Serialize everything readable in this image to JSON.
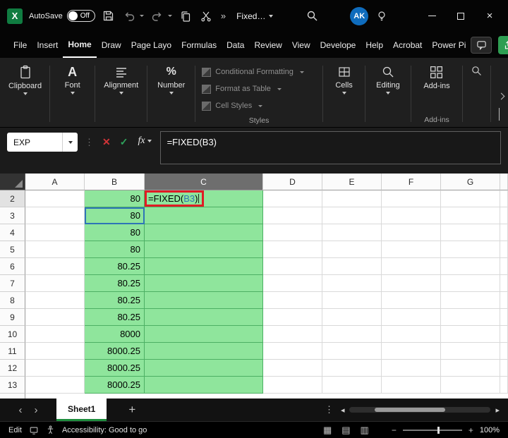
{
  "title_bar": {
    "autosave_label": "AutoSave",
    "autosave_state": "Off",
    "overflow_chevron": "»",
    "doc_title": "Fixed…",
    "avatar_initials": "AK"
  },
  "ribbon_tabs": {
    "active": "Home",
    "items": [
      "File",
      "Insert",
      "Home",
      "Draw",
      "Page Layo",
      "Formulas",
      "Data",
      "Review",
      "View",
      "Develope",
      "Help",
      "Acrobat",
      "Power Pi"
    ]
  },
  "ribbon": {
    "clipboard_label": "Clipboard",
    "font_label": "Font",
    "alignment_label": "Alignment",
    "number_label": "Number",
    "styles_group_label": "Styles",
    "styles_items": [
      "Conditional Formatting",
      "Format as Table",
      "Cell Styles"
    ],
    "cells_label": "Cells",
    "editing_label": "Editing",
    "addins_button_label": "Add-ins",
    "addins_group_label": "Add-ins"
  },
  "formula_bar": {
    "name_box_value": "EXP",
    "fx_label": "fx",
    "formula": "=FIXED(B3)"
  },
  "grid": {
    "columns": [
      "A",
      "B",
      "C",
      "D",
      "E",
      "F",
      "G"
    ],
    "selected_column": "C",
    "rows": [
      2,
      3,
      4,
      5,
      6,
      7,
      8,
      9,
      10,
      11,
      12,
      13
    ],
    "b_values": [
      "80",
      "80",
      "80",
      "80",
      "80.25",
      "80.25",
      "80.25",
      "80.25",
      "8000",
      "8000.25",
      "8000.25",
      "8000.25"
    ],
    "c2_formula": {
      "prefix": "=FIXED(",
      "ref": "B3",
      "suffix": ")"
    }
  },
  "sheet_bar": {
    "tab_label": "Sheet1"
  },
  "status_bar": {
    "mode": "Edit",
    "accessibility_text": "Accessibility: Good to go",
    "zoom_label": "100%"
  },
  "colors": {
    "fill_green": "#8fe59c",
    "grid_green_line": "#4db064",
    "annotation_red": "#e01b24",
    "reference_blue": "#2e75b6",
    "excel_green": "#107c41"
  }
}
